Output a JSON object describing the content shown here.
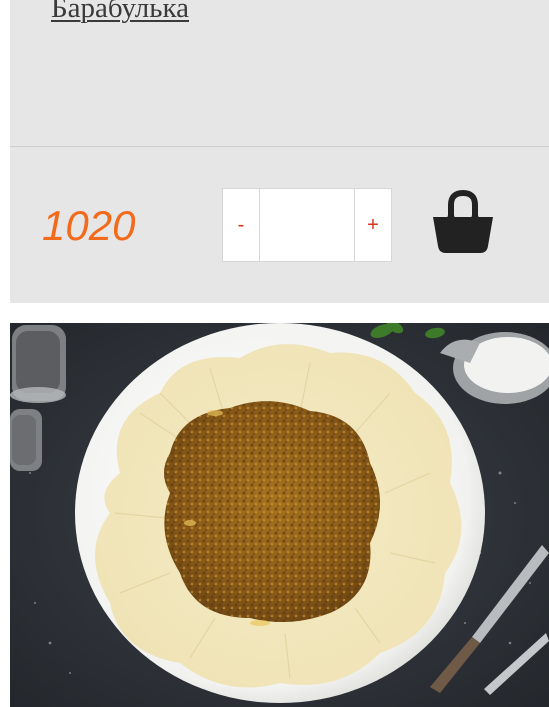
{
  "product": {
    "title": "Барабулька",
    "price": "1020",
    "quantity": {
      "minus_label": "-",
      "plus_label": "+",
      "value": ""
    },
    "cart_icon": "shopping-bag-icon"
  },
  "next_product": {
    "image": "khinkal-dish-photo"
  },
  "colors": {
    "price": "#f26a1b",
    "stepper_buttons": "#d9331b",
    "card_background": "#e6e6e6"
  }
}
